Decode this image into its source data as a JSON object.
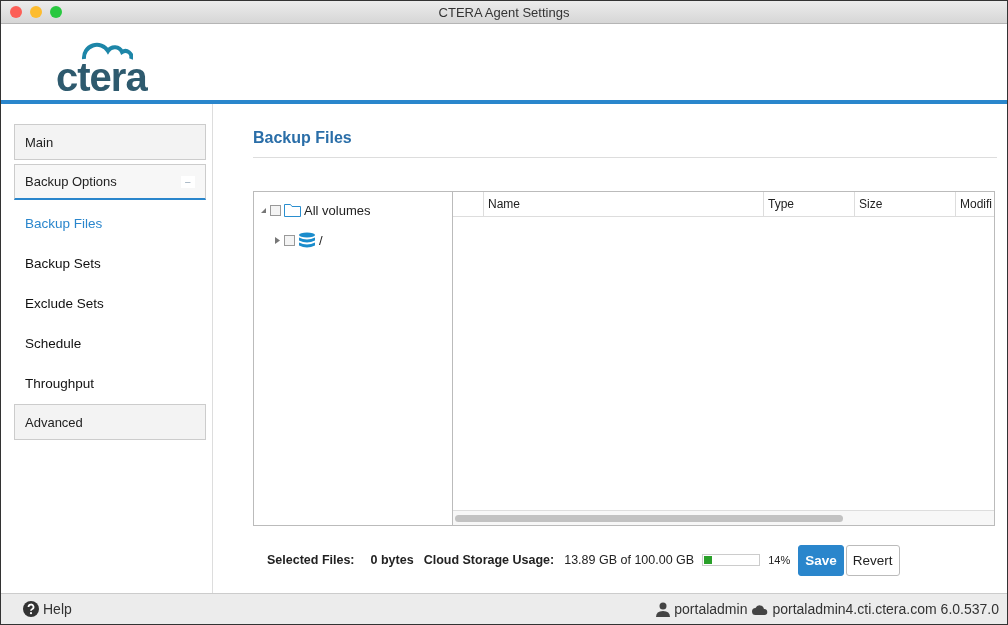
{
  "window": {
    "title": "CTERA Agent Settings"
  },
  "logo": {
    "text": "ctera"
  },
  "sidebar": {
    "sections": [
      {
        "label": "Main",
        "expanded": false
      },
      {
        "label": "Backup Options",
        "expanded": true,
        "toggle": "−",
        "children": [
          {
            "label": "Backup Files",
            "selected": true
          },
          {
            "label": "Backup Sets",
            "selected": false
          },
          {
            "label": "Exclude Sets",
            "selected": false
          },
          {
            "label": "Schedule",
            "selected": false
          },
          {
            "label": "Throughput",
            "selected": false
          }
        ]
      },
      {
        "label": "Advanced",
        "expanded": false
      }
    ]
  },
  "page": {
    "title": "Backup Files"
  },
  "tree": [
    {
      "label": "All volumes",
      "kind": "folder",
      "expanded": true,
      "checked": false,
      "children": [
        {
          "label": "/",
          "kind": "drive",
          "expanded": false,
          "checked": false
        }
      ]
    }
  ],
  "table": {
    "columns": [
      "",
      "Name",
      "Type",
      "Size",
      "Modifi"
    ]
  },
  "summary": {
    "selected_label": "Selected Files:",
    "selected_value": "0 bytes",
    "usage_label": "Cloud Storage Usage:",
    "usage_value": "13.89 GB of 100.00 GB",
    "level": 0.14,
    "percent": "14%"
  },
  "buttons": [
    {
      "label": "Save",
      "kind": "primary"
    },
    {
      "label": "Revert",
      "kind": "default"
    }
  ],
  "status_bar": {
    "help": "Help",
    "user": "portaladmin",
    "server": "portaladmin4.cti.ctera.com",
    "version": "6.0.537.0"
  }
}
